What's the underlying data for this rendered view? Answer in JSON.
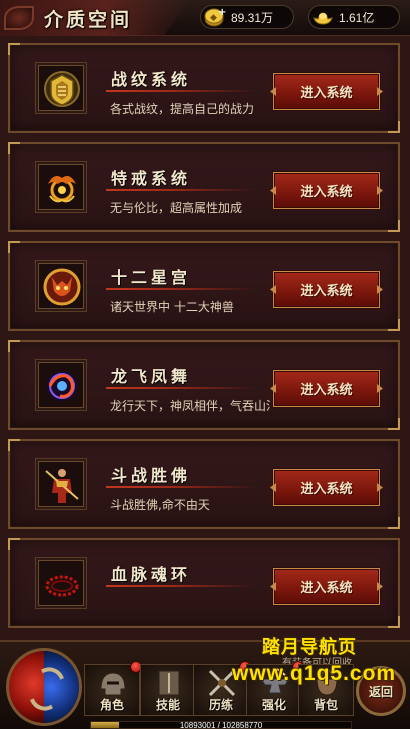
{
  "header": {
    "title": "介质空间",
    "gold": {
      "icon": "gold-coin-icon",
      "value": "89.31万"
    },
    "ingot": {
      "icon": "gold-ingot-icon",
      "value": "1.61亿"
    },
    "close_label": "×"
  },
  "systems": [
    {
      "icon": "golden-emblem-icon",
      "title": "战纹系统",
      "desc": "各式战纹，提高自己的战力",
      "button": "进入系统"
    },
    {
      "icon": "phoenix-ring-icon",
      "title": "特戒系统",
      "desc": "无与伦比，超高属性加成",
      "button": "进入系统"
    },
    {
      "icon": "beast-medallion-icon",
      "title": "十二星宫",
      "desc": "诸天世界中 十二大神兽",
      "button": "进入系统"
    },
    {
      "icon": "dragon-orb-icon",
      "title": "龙飞凤舞",
      "desc": "龙行天下，神凤相伴，气吞山河",
      "button": "进入系统"
    },
    {
      "icon": "warrior-figure-icon",
      "title": "斗战胜佛",
      "desc": "斗战胜佛,命不由天",
      "button": "进入系统"
    },
    {
      "icon": "blood-ring-icon",
      "title": "血脉魂环",
      "desc": "",
      "button": "进入系统"
    }
  ],
  "hud": {
    "buttons": [
      {
        "icon": "helmet-icon",
        "label": "角色"
      },
      {
        "icon": "skill-book-icon",
        "label": "技能"
      },
      {
        "icon": "swords-icon",
        "label": "历练"
      },
      {
        "icon": "anvil-icon",
        "label": "强化"
      },
      {
        "icon": "bag-icon",
        "label": "背包"
      }
    ],
    "return_label": "返回",
    "exp_text": "10893001 / 102858770",
    "exp_fraction": 0.106,
    "tip": "有装备可以回收"
  },
  "watermark": {
    "line1": "踏月导航页",
    "line2": "www.q1q5.com"
  }
}
